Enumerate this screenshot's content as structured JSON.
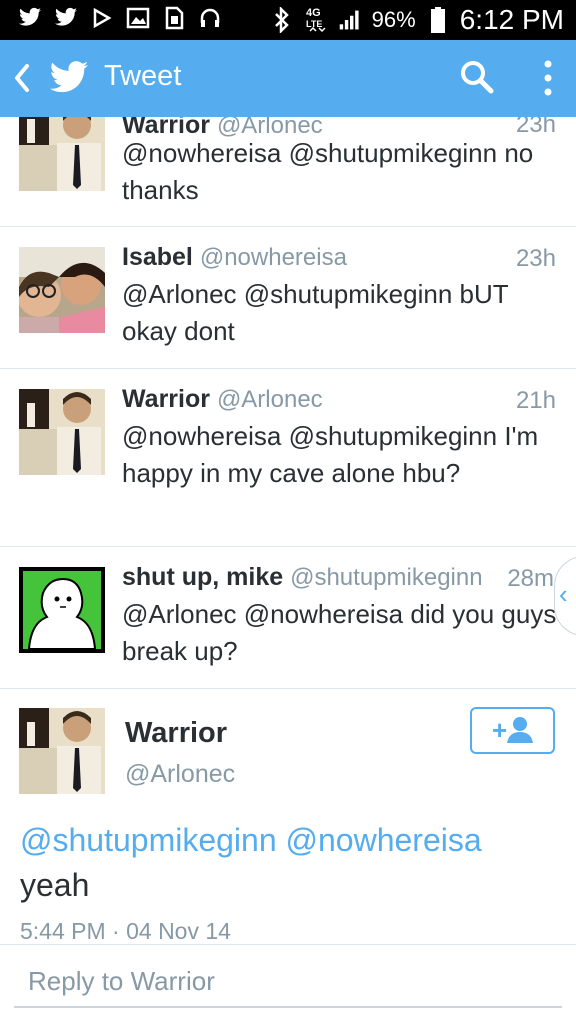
{
  "status_bar": {
    "icons": [
      "twitter-icon",
      "twitter-icon",
      "play-store-icon",
      "gallery-icon",
      "sim-icon",
      "headphones-icon",
      "bluetooth-icon",
      "lte-icon",
      "signal-icon",
      "battery-icon"
    ],
    "battery": "96%",
    "time": "6:12 PM"
  },
  "app_bar": {
    "title": "Tweet",
    "color": "#55acee"
  },
  "tweets": [
    {
      "name": "Warrior",
      "handle": "@Arlonec",
      "time": "23h",
      "text": "@nowhereisa @shutupmikeginn no thanks"
    },
    {
      "name": "Isabel",
      "handle": "@nowhereisa",
      "time": "23h",
      "text": "@Arlonec @shutupmikeginn bUT okay dont"
    },
    {
      "name": "Warrior",
      "handle": "@Arlonec",
      "time": "21h",
      "text": "@nowhereisa @shutupmikeginn I'm happy in my cave alone hbu?"
    },
    {
      "name": "shut up, mike",
      "handle": "@shutupmikeginn",
      "time": "28m",
      "text": "@Arlonec @nowhereisa did you guys break up?"
    }
  ],
  "detail": {
    "name": "Warrior",
    "handle": "@Arlonec",
    "mention1": "@shutupmikeginn",
    "mention2": "@nowhereisa",
    "body": "yeah",
    "timestamp": "5:44 PM · 04 Nov 14",
    "follow_label": "+"
  },
  "reply": {
    "placeholder": "Reply to Warrior"
  }
}
